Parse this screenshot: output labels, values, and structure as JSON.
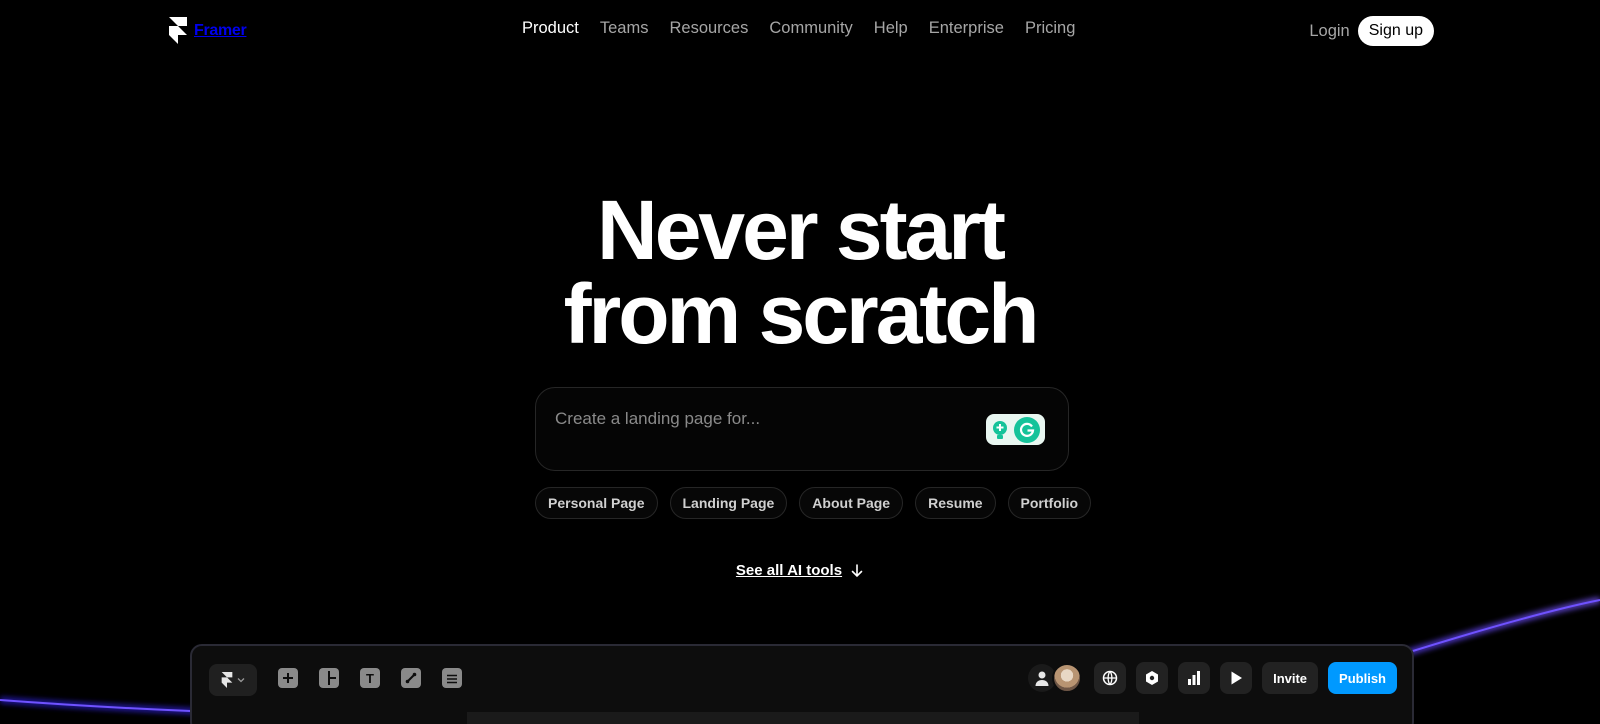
{
  "nav": {
    "brand": "Framer",
    "links": [
      "Product",
      "Teams",
      "Resources",
      "Community",
      "Help",
      "Enterprise",
      "Pricing"
    ],
    "active": "Product",
    "login": "Login",
    "signup": "Sign up"
  },
  "hero": {
    "title_line1": "Never start",
    "title_line2": "from scratch",
    "prompt_placeholder": "Create a landing page for...",
    "chips": [
      "Personal Page",
      "Landing Page",
      "About Page",
      "Resume",
      "Portfolio"
    ],
    "see_all": "See all AI tools"
  },
  "editor": {
    "tools": [
      "plus-icon",
      "layout-icon",
      "text-icon",
      "vector-icon",
      "database-icon"
    ],
    "tool_glyphs": [
      "+",
      "",
      "T",
      "",
      ""
    ],
    "invite": "Invite",
    "publish": "Publish"
  },
  "colors": {
    "background": "#000000",
    "accent": "#0099ff",
    "glow": "#5533ff",
    "assistant": "#15c39a"
  }
}
